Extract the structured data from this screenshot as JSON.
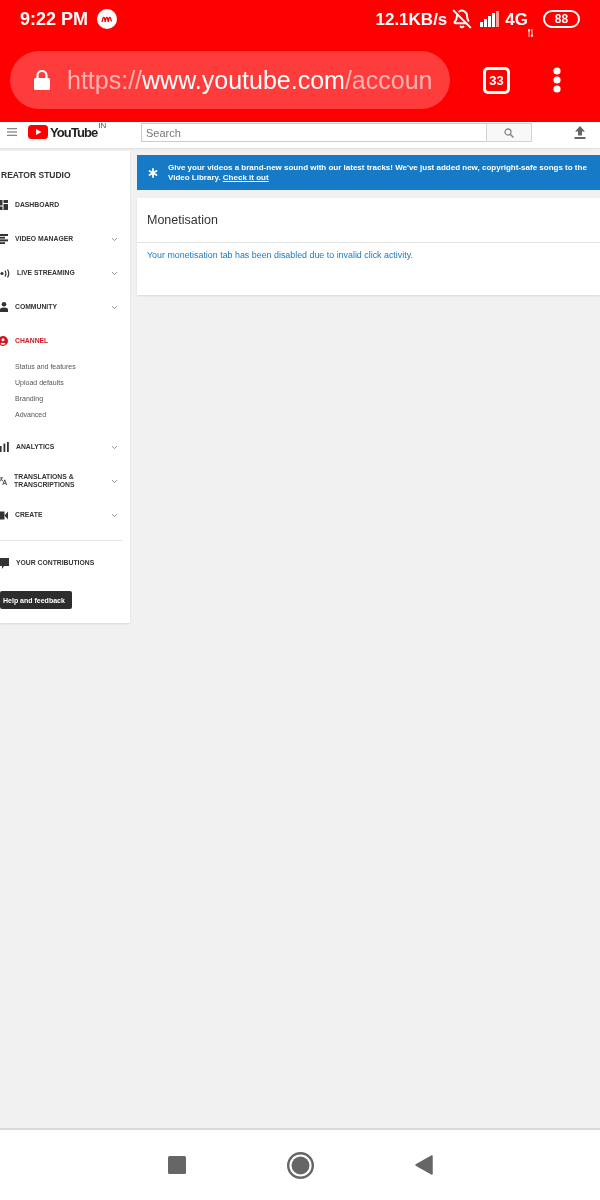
{
  "status_bar": {
    "time": "9:22 PM",
    "network_speed": "12.1KB/s",
    "network_type": "4G",
    "battery": "88"
  },
  "browser_bar": {
    "url": {
      "scheme": "https://",
      "host": "www.youtube.com",
      "path": "/accoun"
    },
    "tab_count": "33"
  },
  "header": {
    "logo": "YouTube",
    "country": "IN",
    "search": {
      "placeholder": "Search"
    }
  },
  "sidebar": {
    "title": "REATOR STUDIO",
    "items": [
      {
        "label": "DASHBOARD",
        "selected": false,
        "expandable": false
      },
      {
        "label": "VIDEO MANAGER",
        "selected": false,
        "expandable": true
      },
      {
        "label": "LIVE STREAMING",
        "selected": false,
        "expandable": true
      },
      {
        "label": "COMMUNITY",
        "selected": false,
        "expandable": true
      },
      {
        "label": "CHANNEL",
        "selected": true,
        "expandable": false,
        "children": [
          {
            "label": "Status and features",
            "selected": false
          },
          {
            "label": "Upload defaults",
            "selected": false
          },
          {
            "label": "Branding",
            "selected": false
          },
          {
            "label": "Advanced",
            "selected": false
          }
        ]
      },
      {
        "label": "ANALYTICS",
        "selected": false,
        "expandable": true
      },
      {
        "label": "TRANSLATIONS & TRANSCRIPTIONS",
        "selected": false,
        "expandable": true
      },
      {
        "label": "CREATE",
        "selected": false,
        "expandable": true
      }
    ],
    "secondary_items": [
      {
        "label": "YOUR CONTRIBUTIONS",
        "selected": false
      }
    ],
    "help_button": "Help and feedback"
  },
  "banner": {
    "text": "Give your videos a brand-new sound with our latest tracks! We've just added new, copyright-safe songs to the Video Library.",
    "link": "Check it out"
  },
  "card": {
    "title": "Monetisation",
    "message": "Your monetisation tab has been disabled due to invalid click activity."
  }
}
